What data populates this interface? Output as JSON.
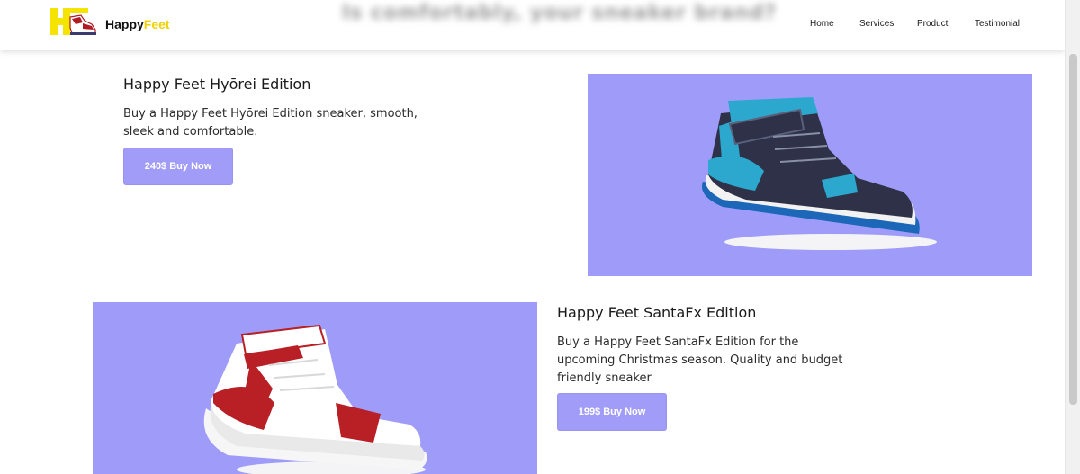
{
  "header": {
    "brand_part1": "Happy",
    "brand_part2": "Feet",
    "blurred_heading": "Is comfortably, your sneaker brand?",
    "nav": [
      "Home",
      "Services",
      "Product",
      "Testimonial"
    ]
  },
  "products": [
    {
      "title": "Happy Feet Hyōrei Edition",
      "desc_line1": "Buy a Happy Feet Hyōrei Edition sneaker, smooth,",
      "desc_line2": "sleek and comfortable.",
      "button": "240$ Buy Now"
    },
    {
      "title": "Happy Feet SantaFx Edition",
      "desc_line1": "Buy a Happy Feet SantaFx Edition for the",
      "desc_line2": "upcoming Christmas season. Quality and budget",
      "desc_line3": "friendly sneaker",
      "button": "199$ Buy Now"
    }
  ],
  "colors": {
    "accent": "#a09cf7",
    "panel_bg": "#9f9cf9",
    "brand_yellow": "#f2d200"
  },
  "icons": [
    "happy-feet-logo",
    "blue-sneaker-image",
    "red-sneaker-image"
  ]
}
